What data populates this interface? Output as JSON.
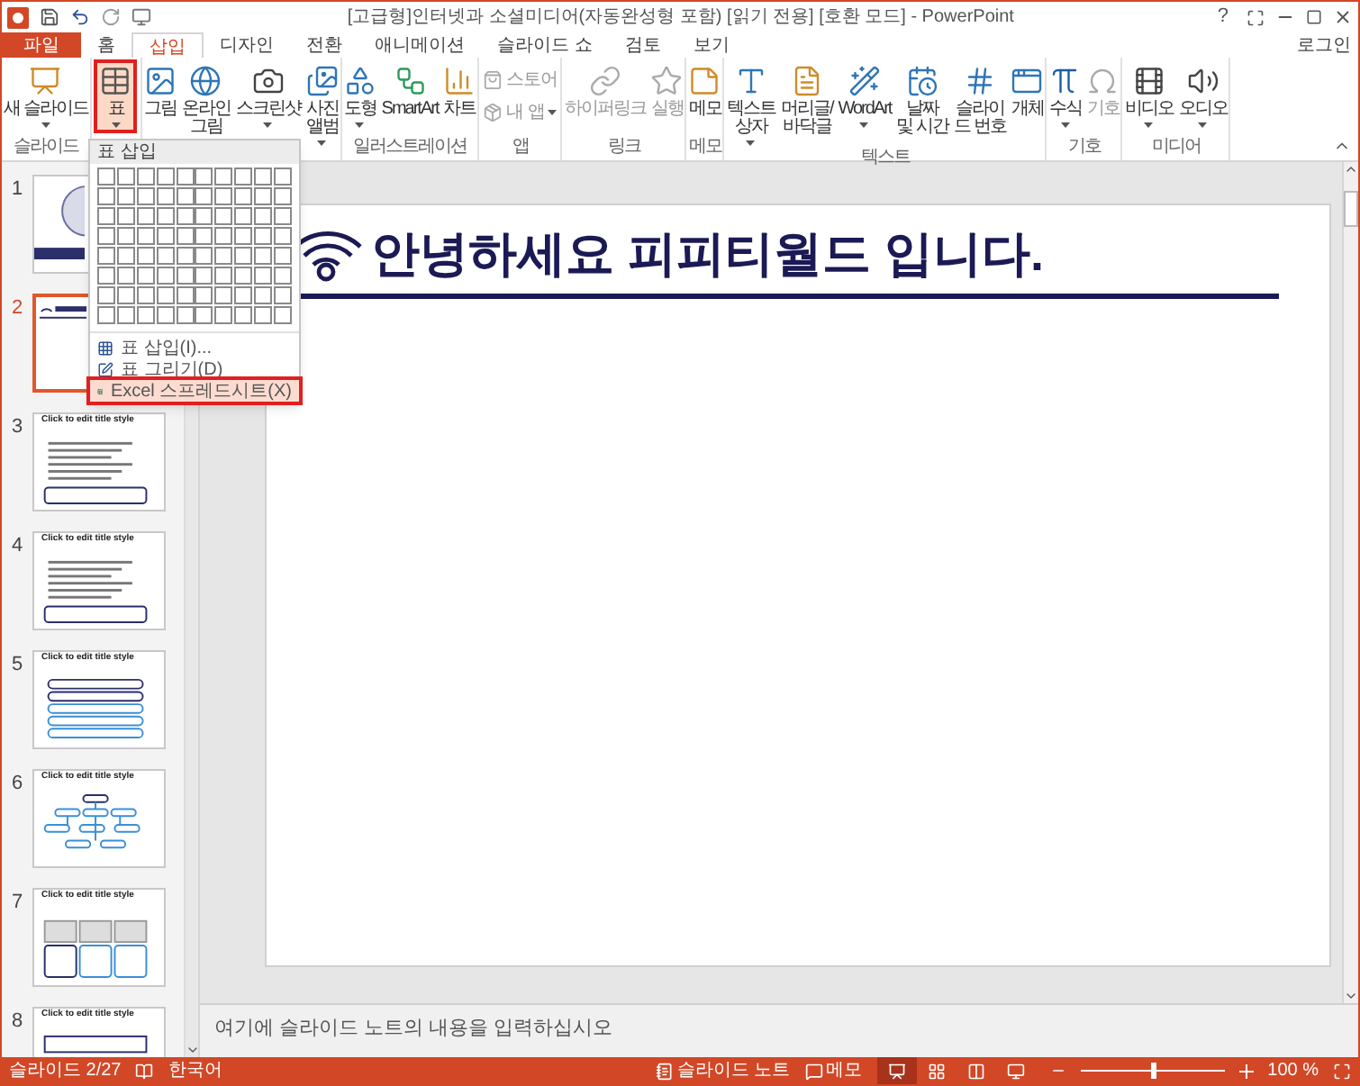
{
  "window": {
    "title": "[고급형]인터넷과 소셜미디어(자동완성형 포함) [읽기 전용] [호환 모드] - PowerPoint",
    "help": "?"
  },
  "tabs": [
    {
      "label": "파일",
      "kind": "file",
      "selected": false
    },
    {
      "label": "홈",
      "kind": "tab",
      "selected": false
    },
    {
      "label": "삽입",
      "kind": "tab",
      "selected": true
    },
    {
      "label": "디자인",
      "kind": "tab",
      "selected": false
    },
    {
      "label": "전환",
      "kind": "tab",
      "selected": false
    },
    {
      "label": "애니메이션",
      "kind": "tab",
      "selected": false
    },
    {
      "label": "슬라이드 쇼",
      "kind": "tab",
      "selected": false
    },
    {
      "label": "검토",
      "kind": "tab",
      "selected": false
    },
    {
      "label": "보기",
      "kind": "tab",
      "selected": false
    }
  ],
  "account": "로그인",
  "ribbon": {
    "groups": [
      {
        "label": "슬라이드",
        "buttons": [
          {
            "label": "새 슬라이드",
            "kind": "large",
            "dropdown": true,
            "disabled": false,
            "pressed": false
          }
        ]
      },
      {
        "buttons": [
          {
            "label": "표",
            "kind": "large",
            "dropdown": true,
            "disabled": false,
            "pressed": true
          }
        ]
      },
      {
        "buttons": [
          {
            "label": "그림",
            "kind": "large",
            "dropdown": false,
            "disabled": false,
            "pressed": false
          },
          {
            "label": "온라인\n그림",
            "kind": "large",
            "dropdown": false,
            "disabled": false,
            "pressed": false
          },
          {
            "label": "스크린샷",
            "kind": "large",
            "dropdown": true,
            "disabled": false,
            "pressed": false
          },
          {
            "label": "사진\n앨범",
            "kind": "large",
            "dropdown": true,
            "disabled": false,
            "pressed": false
          }
        ]
      },
      {
        "label": "일러스트레이션",
        "buttons": [
          {
            "label": "도형",
            "kind": "large",
            "dropdown": true,
            "disabled": false,
            "pressed": false
          },
          {
            "label": "SmartArt",
            "kind": "large",
            "dropdown": false,
            "disabled": false,
            "pressed": false
          },
          {
            "label": "차트",
            "kind": "large",
            "dropdown": false,
            "disabled": false,
            "pressed": false
          }
        ]
      },
      {
        "label": "앱",
        "buttons": [
          {
            "label": "스토어",
            "kind": "small",
            "dropdown": false,
            "disabled": true,
            "pressed": false
          },
          {
            "label": "내 앱",
            "kind": "small",
            "dropdown": true,
            "disabled": true,
            "pressed": false
          }
        ]
      },
      {
        "label": "링크",
        "buttons": [
          {
            "label": "하이퍼링크",
            "kind": "large",
            "dropdown": false,
            "disabled": true,
            "pressed": false
          },
          {
            "label": "실행",
            "kind": "large",
            "dropdown": false,
            "disabled": true,
            "pressed": false
          }
        ]
      },
      {
        "label": "메모",
        "buttons": [
          {
            "label": "메모",
            "kind": "large",
            "dropdown": false,
            "disabled": false,
            "pressed": false
          }
        ]
      },
      {
        "label": "텍스트",
        "buttons": [
          {
            "label": "텍스트\n상자",
            "kind": "large",
            "dropdown": true,
            "disabled": false,
            "pressed": false
          },
          {
            "label": "머리글/\n바닥글",
            "kind": "large",
            "dropdown": false,
            "disabled": false,
            "pressed": false
          },
          {
            "label": "WordArt",
            "kind": "large",
            "dropdown": true,
            "disabled": false,
            "pressed": false
          },
          {
            "label": "날짜\n및 시간",
            "kind": "large",
            "dropdown": false,
            "disabled": false,
            "pressed": false
          },
          {
            "label": "슬라이\n드 번호",
            "kind": "large",
            "dropdown": false,
            "disabled": false,
            "pressed": false
          },
          {
            "label": "개체",
            "kind": "large",
            "dropdown": false,
            "disabled": false,
            "pressed": false
          }
        ]
      },
      {
        "label": "기호",
        "buttons": [
          {
            "label": "수식",
            "kind": "large",
            "dropdown": true,
            "disabled": false,
            "pressed": false
          },
          {
            "label": "기호",
            "kind": "large",
            "dropdown": false,
            "disabled": true,
            "pressed": false
          }
        ]
      },
      {
        "label": "미디어",
        "buttons": [
          {
            "label": "비디오",
            "kind": "large",
            "dropdown": true,
            "disabled": false,
            "pressed": false
          },
          {
            "label": "오디오",
            "kind": "large",
            "dropdown": true,
            "disabled": false,
            "pressed": false
          }
        ]
      }
    ]
  },
  "table_menu": {
    "title": "표 삽입",
    "items": [
      {
        "label": "표 삽입(I)...",
        "highlighted": false
      },
      {
        "label": "표 그리기(D)",
        "highlighted": false
      },
      {
        "label": "Excel 스프레드시트(X)",
        "highlighted": true
      }
    ]
  },
  "slides": [
    {
      "number": "1",
      "kind": "cover",
      "selected": false
    },
    {
      "number": "2",
      "kind": "heading",
      "selected": true
    },
    {
      "number": "3",
      "kind": "bullets",
      "title": "Click to edit title style",
      "selected": false
    },
    {
      "number": "4",
      "kind": "bullets",
      "title": "Click to edit title style",
      "selected": false
    },
    {
      "number": "5",
      "kind": "list",
      "title": "Click to edit title style",
      "selected": false
    },
    {
      "number": "6",
      "kind": "tree",
      "title": "Click to edit title style",
      "selected": false
    },
    {
      "number": "7",
      "kind": "cards",
      "title": "Click to edit title style",
      "selected": false
    },
    {
      "number": "8",
      "kind": "steps",
      "title": "Click to edit title style",
      "selected": false
    }
  ],
  "slide": {
    "title": "안녕하세요 피피티월드 입니다."
  },
  "notes": {
    "placeholder": "여기에 슬라이드 노트의 내용을 입력하십시오"
  },
  "status_bar": {
    "slide": "슬라이드 2/27",
    "language": "한국어",
    "notes": "슬라이드 노트",
    "comments": "메모",
    "zoom": "100 %",
    "zoom_level": {
      "level": 0.5
    },
    "views": [
      {
        "selected": true
      },
      {
        "selected": false
      },
      {
        "selected": false
      },
      {
        "selected": false
      }
    ]
  }
}
